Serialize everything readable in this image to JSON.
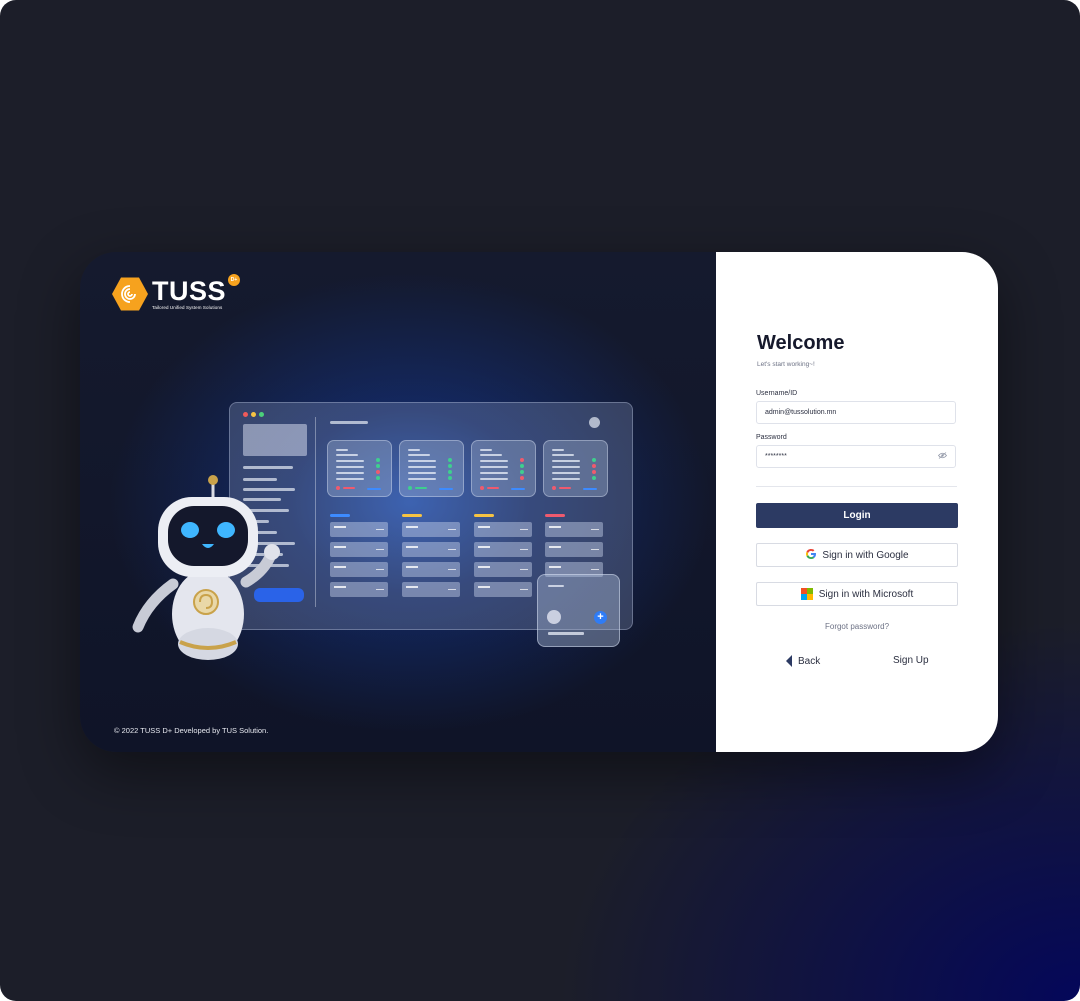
{
  "brand": {
    "name": "TUSS",
    "tagline": "Tailored Unified System Solutions",
    "badge": "D+",
    "accent": "#f6a21e",
    "copyright": "© 2022 TUSS D+ Developed by TUS Solution."
  },
  "illustration": {
    "mascot": "robot-mascot",
    "window_dot_colors": [
      "#ef5a5a",
      "#f6c343",
      "#4bd17a"
    ],
    "column_tag_colors": [
      "#3d8bff",
      "#f6c343",
      "#f6c343",
      "#ef5a6e"
    ],
    "status_colors": [
      "#3ecf8e",
      "#ef5a6e"
    ]
  },
  "login": {
    "title": "Welcome",
    "subtitle": "Let's start working~!",
    "username_label": "Username/ID",
    "username_value": "admin@tussolution.mn",
    "password_label": "Password",
    "password_value": "********",
    "password_toggle_icon": "eye-slash-icon",
    "login_button": "Login",
    "google_button": "Sign in with Google",
    "microsoft_button": "Sign in with Microsoft",
    "forgot_link": "Forgot password?",
    "back_label": "Back",
    "signup_label": "Sign Up",
    "primary_color": "#2c3a63"
  }
}
